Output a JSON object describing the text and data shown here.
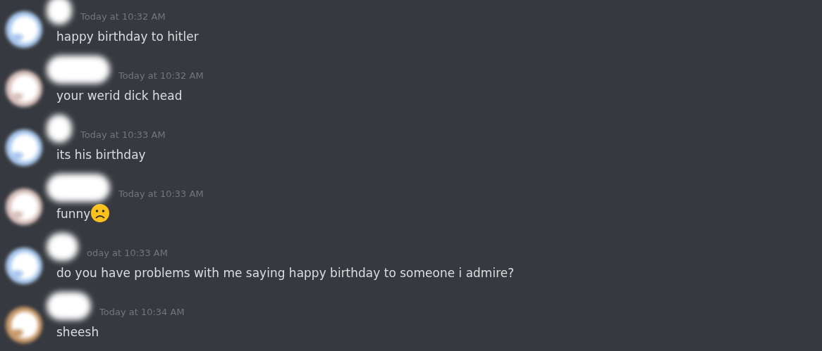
{
  "messages": [
    {
      "timestamp": "Today at 10:32 AM",
      "text": "happy birthday to hitler",
      "frown_emoji": false
    },
    {
      "timestamp": "Today at 10:32 AM",
      "text": "your werid dick head",
      "frown_emoji": false
    },
    {
      "timestamp": "Today at 10:33 AM",
      "text": "its his birthday",
      "frown_emoji": false
    },
    {
      "timestamp": "Today at 10:33 AM",
      "text": "funny",
      "frown_emoji": true
    },
    {
      "timestamp": "oday at 10:33 AM",
      "text": "do you have problems with me saying happy birthday to someone i admire?",
      "frown_emoji": false
    },
    {
      "timestamp": "Today at 10:34 AM",
      "text": "sheesh",
      "frown_emoji": false
    }
  ]
}
